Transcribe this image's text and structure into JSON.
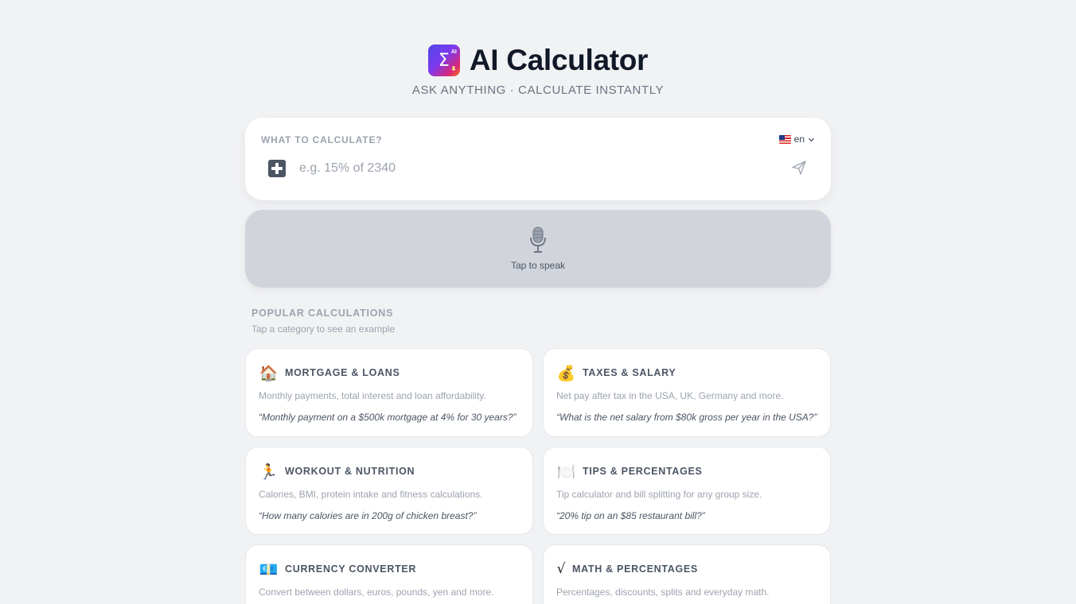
{
  "header": {
    "title": "AI Calculator",
    "subtitle": "ASK ANYTHING · CALCULATE INSTANTLY",
    "logo": {
      "ai_label": "AI",
      "symbol": "Σ"
    }
  },
  "input": {
    "label": "WHAT TO CALCULATE?",
    "placeholder": "e.g. 15% of 2340",
    "value": "",
    "language": "en",
    "add_icon": "plus-icon",
    "send_icon": "send-icon"
  },
  "voice": {
    "label": "Tap to speak",
    "icon": "microphone-icon"
  },
  "popular": {
    "title": "POPULAR CALCULATIONS",
    "subtitle": "Tap a category to see an example",
    "categories": [
      {
        "icon": "🏠",
        "title": "MORTGAGE & LOANS",
        "description": "Monthly payments, total interest and loan affordability.",
        "example": "“Monthly payment on a $500k mortgage at 4% for 30 years?”"
      },
      {
        "icon": "💰",
        "title": "TAXES & SALARY",
        "description": "Net pay after tax in the USA, UK, Germany and more.",
        "example": "“What is the net salary from $80k gross per year in the USA?”"
      },
      {
        "icon": "🏃",
        "title": "WORKOUT & NUTRITION",
        "description": "Calories, BMI, protein intake and fitness calculations.",
        "example": "“How many calories are in 200g of chicken breast?”"
      },
      {
        "icon": "🍽️",
        "title": "TIPS & PERCENTAGES",
        "description": "Tip calculator and bill splitting for any group size.",
        "example": "“20% tip on an $85 restaurant bill?”"
      },
      {
        "icon": "💶",
        "title": "CURRENCY CONVERTER",
        "description": "Convert between dollars, euros, pounds, yen and more.",
        "example": ""
      },
      {
        "icon": "√",
        "title": "MATH & PERCENTAGES",
        "description": "Percentages, discounts, splits and everyday math.",
        "example": ""
      }
    ]
  },
  "colors": {
    "background": "#f1f2f4",
    "title": "#111827",
    "muted": "#9ca3af",
    "mic_card": "#d1d5db",
    "logo_gradient": [
      "#4f46e5",
      "#7c3aed",
      "#db2777",
      "#f97316"
    ]
  }
}
